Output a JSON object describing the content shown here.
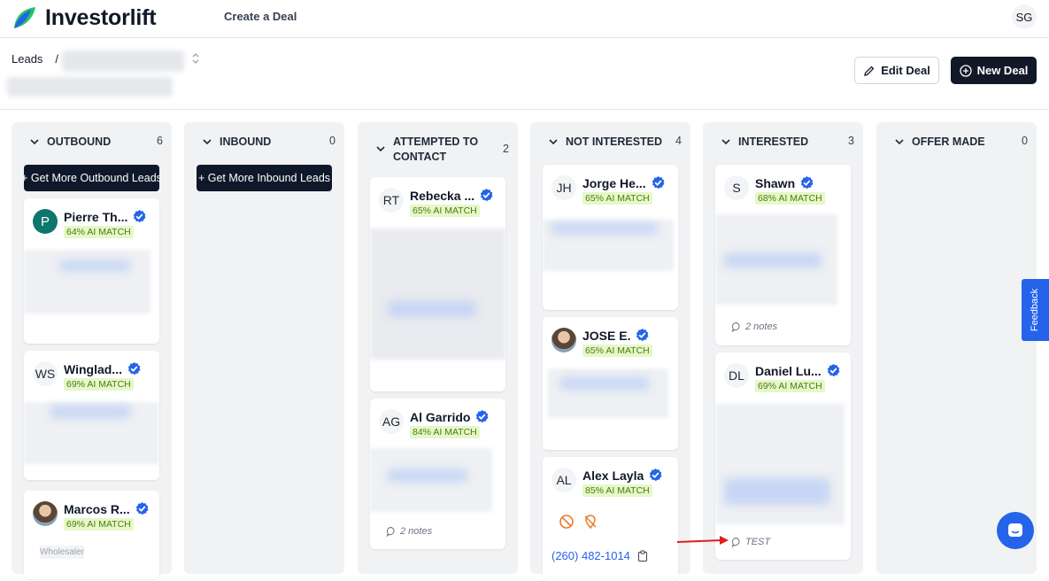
{
  "app": {
    "name": "Investorlift",
    "nav_create": "Create a Deal",
    "user_initials": "SG"
  },
  "breadcrumb": {
    "root": "Leads",
    "separator": "/"
  },
  "actions": {
    "edit": "Edit Deal",
    "new": "New Deal"
  },
  "feedback": "Feedback",
  "colors": {
    "accent": "#2563eb",
    "dark": "#111827",
    "match_bg": "#e6f7c9",
    "match_text": "#4d7c0f",
    "arrow": "#e11d1d"
  },
  "columns": [
    {
      "title": "OUTBOUND",
      "count": "6",
      "get_more": "+ Get More Outbound Leads",
      "cards": [
        {
          "initials": "P",
          "name": "Pierre Th...",
          "match": "64% AI MATCH"
        },
        {
          "initials": "WS",
          "name": "Winglad...",
          "match": "69% AI MATCH"
        },
        {
          "initials": "",
          "name": "Marcos R...",
          "match": "69% AI MATCH",
          "tag": "Wholesaler"
        }
      ]
    },
    {
      "title": "INBOUND",
      "count": "0",
      "get_more": "+ Get More Inbound Leads",
      "cards": []
    },
    {
      "title": "ATTEMPTED TO CONTACT",
      "count": "2",
      "cards": [
        {
          "initials": "RT",
          "name": "Rebecka ...",
          "match": "65% AI MATCH"
        },
        {
          "initials": "AG",
          "name": "Al Garrido",
          "match": "84% AI MATCH",
          "notes": "2 notes"
        }
      ]
    },
    {
      "title": "NOT INTERESTED",
      "count": "4",
      "cards": [
        {
          "initials": "JH",
          "name": "Jorge He...",
          "match": "65% AI MATCH"
        },
        {
          "initials": "",
          "name": "JOSE E.",
          "match": "65% AI MATCH"
        },
        {
          "initials": "AL",
          "name": "Alex Layla",
          "match": "85% AI MATCH",
          "phone": "(260) 482-1014"
        }
      ]
    },
    {
      "title": "INTERESTED",
      "count": "3",
      "cards": [
        {
          "initials": "S",
          "name": "Shawn",
          "match": "68% AI MATCH",
          "notes": "2 notes"
        },
        {
          "initials": "DL",
          "name": "Daniel Lu...",
          "match": "69% AI MATCH",
          "notes": "TEST"
        }
      ]
    },
    {
      "title": "OFFER MADE",
      "count": "0",
      "cards": []
    }
  ]
}
